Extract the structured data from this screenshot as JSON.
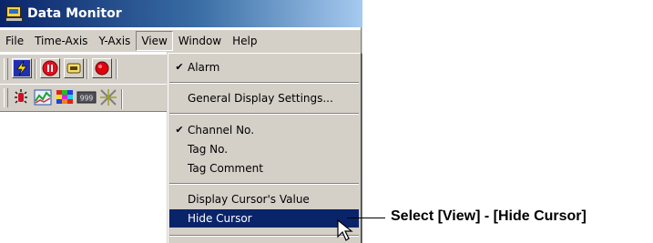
{
  "window": {
    "title": "Data Monitor",
    "title_icon": "monitor-icon"
  },
  "menubar": {
    "items": [
      {
        "label": "File"
      },
      {
        "label": "Time-Axis"
      },
      {
        "label": "Y-Axis"
      },
      {
        "label": "View",
        "active": true
      },
      {
        "label": "Window"
      },
      {
        "label": "Help"
      }
    ]
  },
  "toolbar1": {
    "icons": [
      "lightning-icon",
      "stop-icon",
      "link-icon",
      "record-icon"
    ]
  },
  "toolbar2": {
    "icons": [
      "alarm-icon",
      "graph-icon",
      "color-grid-icon",
      "digital-999-icon",
      "cursor-cross-icon"
    ],
    "digital_text": "999"
  },
  "view_menu": {
    "items": [
      {
        "label": "Alarm",
        "checked": true
      },
      {
        "label": "General Display Settings...",
        "checked": false
      },
      {
        "label": "Channel No.",
        "checked": true
      },
      {
        "label": "Tag No.",
        "checked": false
      },
      {
        "label": "Tag Comment",
        "checked": false
      },
      {
        "label": "Display Cursor's Value",
        "checked": false
      },
      {
        "label": "Hide Cursor",
        "checked": false,
        "highlighted": true
      }
    ],
    "checkmark": "✔"
  },
  "callout": {
    "text": "Select [View] - [Hide Cursor]"
  },
  "colors": {
    "title_gradient_start": "#0a246a",
    "menu_highlight": "#0a246a",
    "face": "#d4d0c8"
  }
}
